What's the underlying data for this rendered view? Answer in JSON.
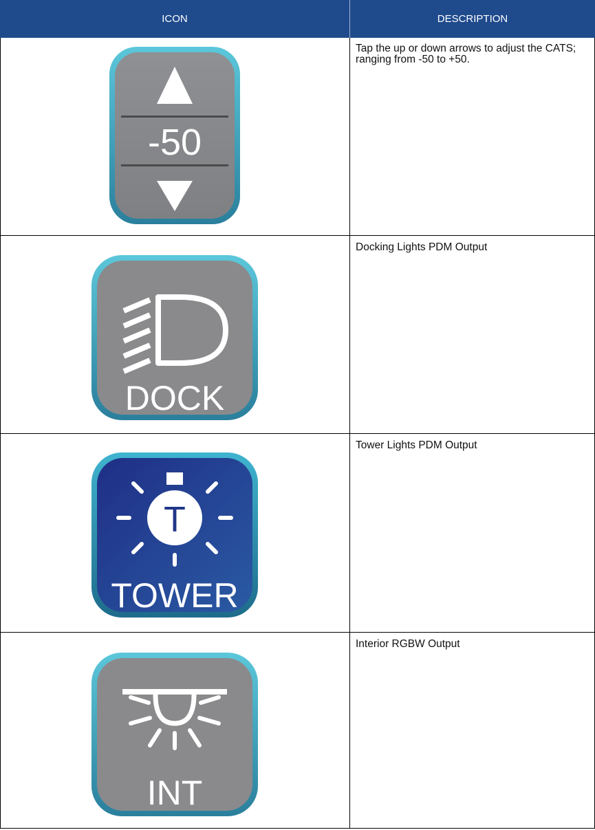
{
  "header": {
    "icon_label": "ICON",
    "description_label": "DESCRIPTION"
  },
  "rows": [
    {
      "icon": "cats-stepper-icon",
      "icon_value": "-50",
      "description": "Tap the up or down arrows to adjust the CATS; ranging from -50 to +50."
    },
    {
      "icon": "docking-light-icon",
      "icon_label": "DOCK",
      "description": "Docking Lights PDM Output"
    },
    {
      "icon": "tower-light-icon",
      "icon_label": "TOWER",
      "description": "Tower Lights PDM Output"
    },
    {
      "icon": "interior-light-icon",
      "icon_label": "INT",
      "description": "Interior RGBW Output"
    }
  ],
  "colors": {
    "header_bg": "#1f4a8c",
    "icon_gray": "#8a8a8c",
    "icon_blue": "#233d93",
    "icon_border": "#3aa6c2"
  }
}
